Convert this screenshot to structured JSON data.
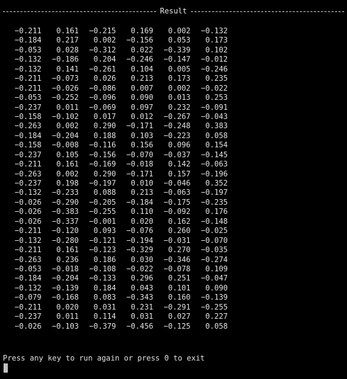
{
  "header": {
    "title": "Result"
  },
  "results": {
    "rows": [
      [
        "−0.211",
        "0.161",
        "−0.215",
        "0.169",
        "0.002",
        "−0.132"
      ],
      [
        "−0.184",
        "0.217",
        "0.002",
        "−0.156",
        "0.053",
        "0.173"
      ],
      [
        "−0.053",
        "0.028",
        "−0.312",
        "0.022",
        "−0.339",
        "0.102"
      ],
      [
        "−0.132",
        "−0.186",
        "0.204",
        "−0.246",
        "−0.147",
        "−0.012"
      ],
      [
        "−0.132",
        "0.141",
        "−0.261",
        "0.104",
        "0.005",
        "−0.246"
      ],
      [
        "−0.211",
        "−0.073",
        "0.026",
        "0.213",
        "0.173",
        "0.235"
      ],
      [
        "−0.211",
        "−0.026",
        "−0.086",
        "0.007",
        "0.002",
        "−0.022"
      ],
      [
        "−0.053",
        "−0.252",
        "−0.096",
        "0.090",
        "0.013",
        "0.253"
      ],
      [
        "−0.237",
        "0.011",
        "−0.069",
        "0.097",
        "0.232",
        "−0.091"
      ],
      [
        "−0.158",
        "−0.102",
        "0.017",
        "0.012",
        "−0.267",
        "−0.043"
      ],
      [
        "−0.263",
        "0.002",
        "0.290",
        "−0.171",
        "−0.248",
        "0.383"
      ],
      [
        "−0.184",
        "−0.204",
        "0.188",
        "0.103",
        "−0.223",
        "0.058"
      ],
      [
        "−0.158",
        "−0.008",
        "−0.116",
        "0.156",
        "0.096",
        "0.154"
      ],
      [
        "−0.237",
        "0.105",
        "−0.156",
        "−0.070",
        "−0.037",
        "−0.145"
      ],
      [
        "−0.211",
        "0.161",
        "−0.169",
        "−0.018",
        "0.142",
        "−0.063"
      ],
      [
        "−0.263",
        "0.002",
        "0.290",
        "−0.171",
        "0.157",
        "−0.196"
      ],
      [
        "−0.237",
        "0.198",
        "−0.197",
        "0.010",
        "−0.046",
        "0.352"
      ],
      [
        "−0.132",
        "−0.233",
        "0.088",
        "0.213",
        "−0.063",
        "−0.197"
      ],
      [
        "−0.026",
        "−0.290",
        "−0.205",
        "−0.184",
        "−0.175",
        "−0.235"
      ],
      [
        "−0.026",
        "−0.383",
        "−0.255",
        "0.110",
        "−0.092",
        "0.176"
      ],
      [
        "−0.026",
        "−0.337",
        "−0.001",
        "0.020",
        "0.162",
        "−0.148"
      ],
      [
        "−0.211",
        "−0.120",
        "0.093",
        "−0.076",
        "0.260",
        "−0.025"
      ],
      [
        "−0.132",
        "−0.280",
        "−0.121",
        "−0.194",
        "−0.031",
        "−0.070"
      ],
      [
        "−0.211",
        "0.161",
        "−0.123",
        "−0.329",
        "0.270",
        "−0.035"
      ],
      [
        "−0.263",
        "0.236",
        "0.186",
        "0.030",
        "−0.346",
        "−0.274"
      ],
      [
        "−0.053",
        "−0.018",
        "−0.108",
        "−0.022",
        "−0.078",
        "0.109"
      ],
      [
        "−0.184",
        "−0.204",
        "−0.133",
        "0.296",
        "0.251",
        "−0.047"
      ],
      [
        "−0.132",
        "−0.139",
        "0.184",
        "0.043",
        "0.101",
        "0.090"
      ],
      [
        "−0.079",
        "−0.168",
        "0.083",
        "−0.343",
        "0.160",
        "−0.139"
      ],
      [
        "−0.211",
        "0.020",
        "0.031",
        "0.231",
        "−0.291",
        "−0.255"
      ],
      [
        "−0.237",
        "0.011",
        "0.114",
        "0.031",
        "0.027",
        "0.227"
      ],
      [
        "−0.026",
        "−0.103",
        "−0.379",
        "−0.456",
        "−0.125",
        "0.058"
      ]
    ]
  },
  "footer": {
    "prompt": "Press any key to run again or press 0 to exit"
  },
  "colors": {
    "background": "#000000",
    "foreground": "#e0e0e0",
    "cursor": "#bfbfbf"
  }
}
